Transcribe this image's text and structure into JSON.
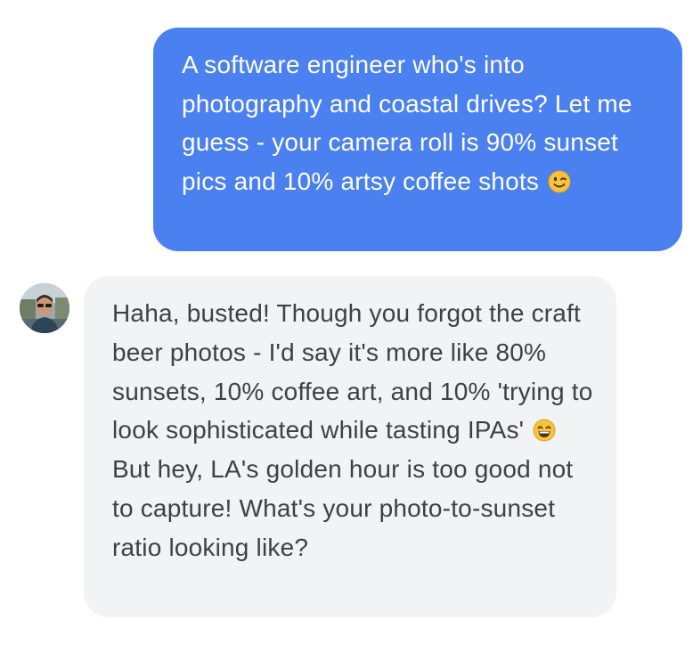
{
  "conversation": {
    "sent_message": {
      "text": "A software engineer who's into photography and coastal drives? Let me guess - your camera roll is 90% sunset pics and 10% artsy coffee shots",
      "emoji": "winking-face",
      "bubble_color": "#4a80ef",
      "text_color": "#ffffff"
    },
    "received_message": {
      "text_before_emoji": "Haha, busted! Though you forgot the craft beer photos - I'd say it's more like 80% sunsets, 10% coffee art, and 10% 'trying to look sophisticated while tasting IPAs'",
      "emoji": "grinning-face-with-smiling-eyes",
      "text_after_emoji": "But hey, LA's golden hour is too good not to capture! What's your photo-to-sunset ratio looking like?",
      "bubble_color": "#f2f3f5",
      "text_color": "#3f3f46",
      "avatar_icon": "profile-photo-avatar"
    }
  }
}
